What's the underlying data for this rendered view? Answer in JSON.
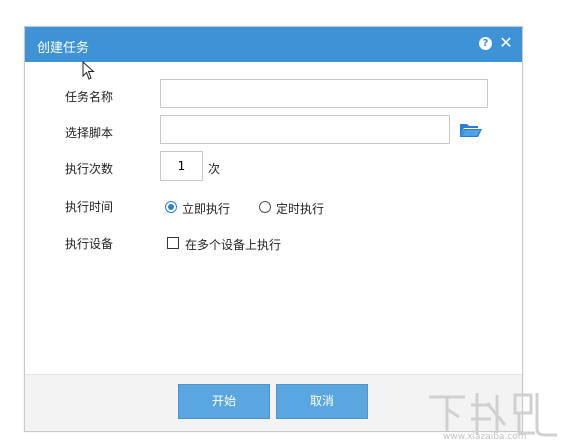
{
  "dialog": {
    "title": "创建任务",
    "help_icon": "?",
    "close_icon": "✕",
    "colors": {
      "titlebar": "#3d93d6",
      "button": "#5aa6e0",
      "radio_selected": "#2a7fd4"
    }
  },
  "form": {
    "task_name": {
      "label": "任务名称",
      "value": "",
      "placeholder": ""
    },
    "script": {
      "label": "选择脚本",
      "value": "",
      "placeholder": "",
      "browse_icon": "folder-open-icon"
    },
    "exec_count": {
      "label": "执行次数",
      "value": "1",
      "unit": "次"
    },
    "exec_time": {
      "label": "执行时间",
      "options": [
        {
          "label": "立即执行",
          "selected": true
        },
        {
          "label": "定时执行",
          "selected": false
        }
      ]
    },
    "exec_device": {
      "label": "执行设备",
      "checkbox_label": "在多个设备上执行",
      "checked": false
    }
  },
  "footer": {
    "start_label": "开始",
    "cancel_label": "取消"
  },
  "watermark": {
    "logo_text": "下载吧",
    "url_text": "www.xiazaiba.com"
  }
}
